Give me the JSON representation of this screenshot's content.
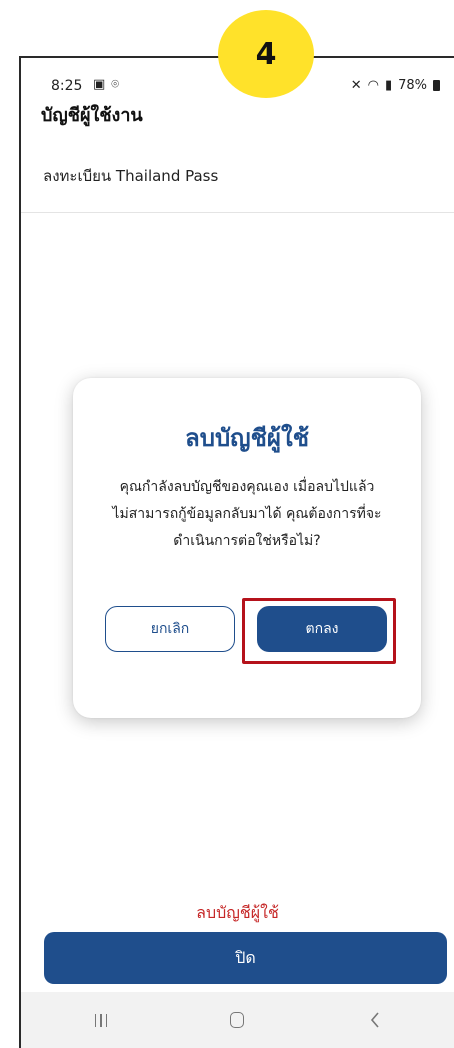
{
  "step_badge": "4",
  "status_bar": {
    "time": "8:25",
    "left_icons": [
      "gallery-icon",
      "location-icon"
    ],
    "right_icons": [
      "mute-icon",
      "wifi-icon",
      "signal-icon",
      "battery-icon"
    ],
    "battery": "78%"
  },
  "header": {
    "title": "บัญชีผู้ใช้งาน",
    "subtitle": "ลงทะเบียน Thailand Pass"
  },
  "dialog": {
    "title": "ลบบัญชีผู้ใช้",
    "body_lines": [
      "คุณกำลังลบบัญชีของคุณเอง เมื่อลบไปแล้ว",
      "ไม่สามารถกู้ข้อมูลกลับมาได้ คุณต้องการที่จะ",
      "ดำเนินการต่อใช่หรือไม่?"
    ],
    "cancel_label": "ยกเลิก",
    "confirm_label": "ตกลง"
  },
  "footer": {
    "delete_account_label": "ลบบัญชีผู้ใช้",
    "close_label": "ปิด"
  },
  "colors": {
    "primary": "#1f4e8c",
    "danger": "#c62828",
    "badge": "#ffe22a",
    "highlight": "#b5121b"
  },
  "nav_bar": {
    "icons": [
      "recents-icon",
      "home-icon",
      "back-icon"
    ]
  }
}
